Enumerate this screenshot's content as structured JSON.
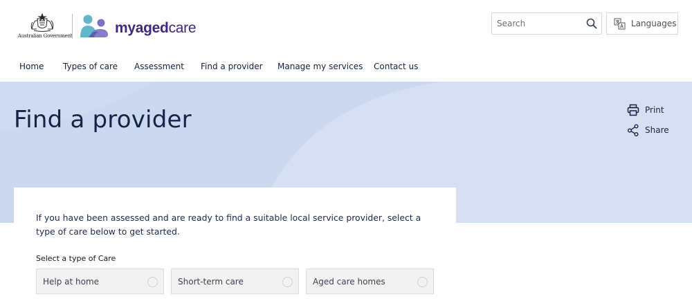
{
  "header": {
    "gov_logo_text": "Australian Government",
    "brand": {
      "my": "my",
      "aged": "aged",
      "care": "care"
    },
    "search": {
      "placeholder": "Search"
    },
    "languages_label": "Languages"
  },
  "nav": {
    "items": [
      {
        "label": "Home"
      },
      {
        "label": "Types of care"
      },
      {
        "label": "Assessment"
      },
      {
        "label": "Find a provider"
      },
      {
        "label": "Manage my services"
      },
      {
        "label": "Contact us"
      }
    ]
  },
  "hero": {
    "title": "Find a provider",
    "print_label": "Print",
    "share_label": "Share"
  },
  "card": {
    "intro": "If you have been assessed and are ready to find a suitable local service provider, select a type of care below to get started.",
    "select_label": "Select a type of Care",
    "options": [
      {
        "label": "Help at home"
      },
      {
        "label": "Short-term care"
      },
      {
        "label": "Aged care homes"
      }
    ]
  },
  "colors": {
    "brand_purple": "#3f2a7a",
    "hero_background": "#ccd8f0",
    "text_navy": "#142348"
  }
}
